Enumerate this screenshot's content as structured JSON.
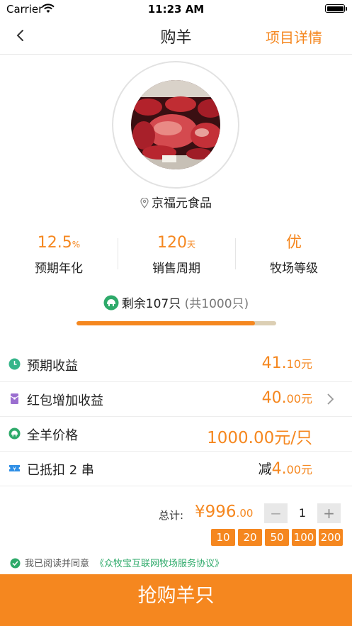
{
  "status_bar": {
    "carrier": "Carrier",
    "time": "11:23 AM"
  },
  "nav": {
    "title": "购羊",
    "detail_link": "项目详情"
  },
  "location": {
    "name": "京福元食品"
  },
  "stats": [
    {
      "value": "12.5",
      "unit": "%",
      "label": "预期年化"
    },
    {
      "value": "120",
      "unit": "天",
      "label": "销售周期"
    },
    {
      "value": "优",
      "unit": "",
      "label": "牧场等级"
    }
  ],
  "remaining": {
    "text": "剩余107只",
    "total": "(共1000只)",
    "progress_fraction": 0.893
  },
  "rows": {
    "income": {
      "label": "预期收益",
      "value": "41.",
      "value_small": "10元"
    },
    "redpacket": {
      "label": "红包增加收益",
      "value": "40.",
      "value_small": "00元"
    },
    "price": {
      "label": "全羊价格",
      "value": "1000.00元/只"
    },
    "discount": {
      "label": "已抵扣 2 串",
      "prefix": "减",
      "value": "4.",
      "value_small": "00元"
    }
  },
  "order": {
    "total_label": "总计:",
    "total_value": "¥996",
    "total_small": ".00",
    "quantity": "1",
    "minus": "−",
    "plus": "+",
    "quick_amounts": [
      "10",
      "20",
      "50",
      "100",
      "200"
    ]
  },
  "agreement": {
    "text": "我已阅读并同意",
    "link": "《众牧宝互联网牧场服务协议》"
  },
  "buy_button": {
    "label": "抢购羊只"
  },
  "colors": {
    "accent": "#f5871f",
    "green": "#2eaa6a"
  }
}
